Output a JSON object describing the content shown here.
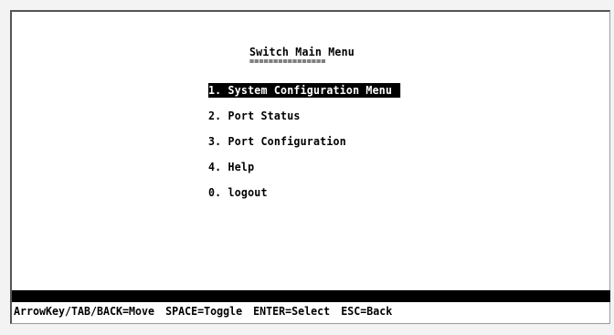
{
  "menu": {
    "title": "Switch Main Menu",
    "title_underline": "================",
    "items": [
      {
        "label": "1. System Configuration Menu",
        "selected": true
      },
      {
        "label": "2. Port Status",
        "selected": false
      },
      {
        "label": "3. Port Configuration",
        "selected": false
      },
      {
        "label": "4. Help",
        "selected": false
      },
      {
        "label": "0. logout",
        "selected": false
      }
    ]
  },
  "hints": {
    "move": "ArrowKey/TAB/BACK=Move",
    "toggle": "SPACE=Toggle",
    "select": "ENTER=Select",
    "back": "ESC=Back"
  },
  "colors": {
    "background": "#ffffff",
    "text": "#000000",
    "highlight": "#000000",
    "highlight_text": "#ffffff"
  }
}
